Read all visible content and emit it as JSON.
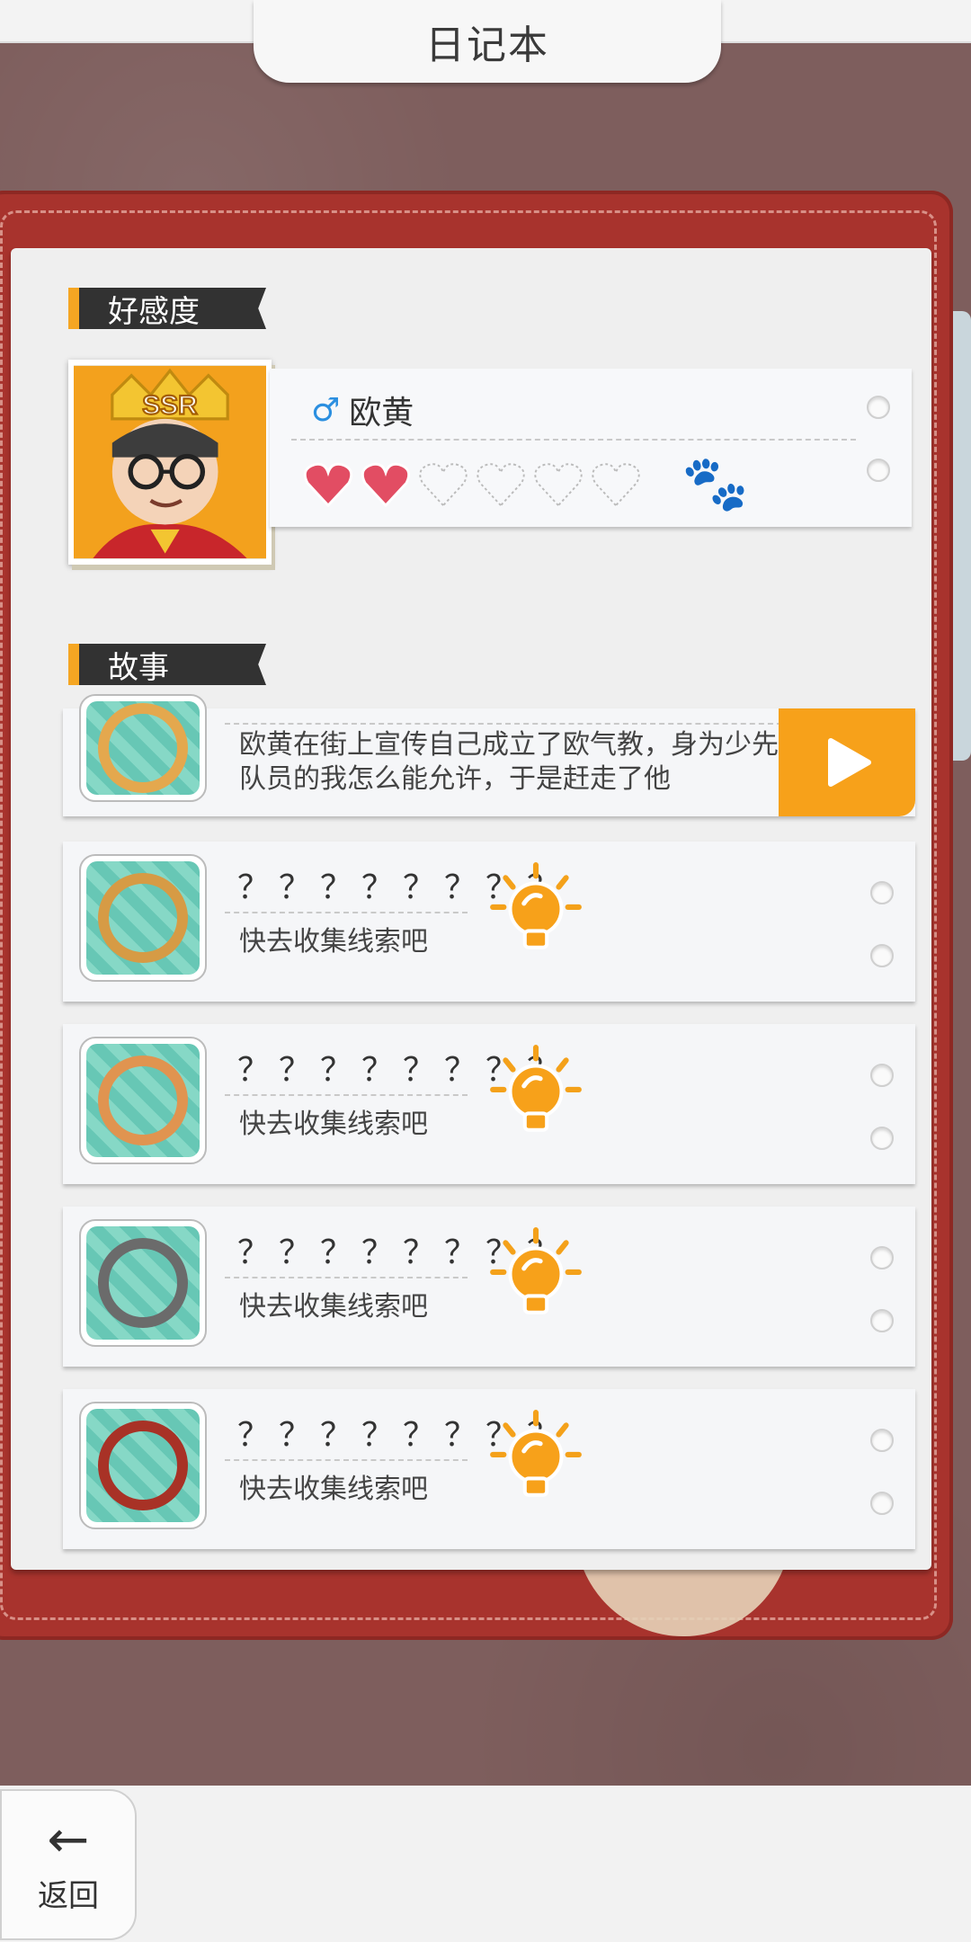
{
  "title": "日记本",
  "sections": {
    "affection": "好感度",
    "story": "故事"
  },
  "profile": {
    "gender_icon": "male-icon",
    "gender_symbol": "♂",
    "name": "欧黄",
    "badge": "SSR",
    "hearts_filled": 2,
    "hearts_total": 6
  },
  "stories": {
    "first": {
      "text": "欧黄在街上宣传自己成立了欧气教，身为少先队员的我怎么能允许，于是赶走了他"
    },
    "locked": [
      {
        "title": "？？？？？？？？",
        "hint": "快去收集线索吧"
      },
      {
        "title": "？？？？？？？？",
        "hint": "快去收集线索吧"
      },
      {
        "title": "？？？？？？？？",
        "hint": "快去收集线索吧"
      },
      {
        "title": "？？？？？？？？",
        "hint": "快去收集线索吧"
      }
    ]
  },
  "back": {
    "label": "返回"
  },
  "colors": {
    "accent": "#f5a623",
    "book": "#a8332d",
    "heart": "#e24d63"
  }
}
